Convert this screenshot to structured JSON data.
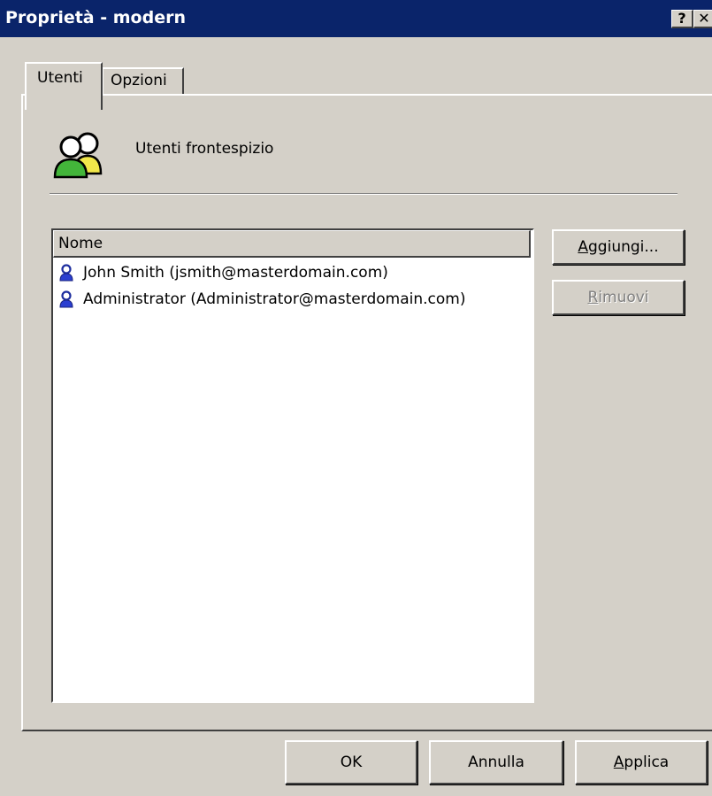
{
  "window": {
    "title": "Proprietà - modern",
    "help_glyph": "?",
    "close_glyph": "✕"
  },
  "tabs": [
    {
      "label": "Utenti",
      "selected": true
    },
    {
      "label": "Opzioni",
      "selected": false
    }
  ],
  "panel": {
    "group_label": "Utenti frontespizio",
    "list_header": "Nome",
    "users": [
      {
        "label": "John Smith (jsmith@masterdomain.com)",
        "icon": "user-icon"
      },
      {
        "label": "Administrator (Administrator@masterdomain.com)",
        "icon": "user-icon"
      }
    ],
    "add_button": {
      "accel": "A",
      "rest": "ggiungi..."
    },
    "remove_button": {
      "accel": "R",
      "rest": "imuovi",
      "disabled": true
    }
  },
  "footer": {
    "ok": "OK",
    "cancel": "Annulla",
    "apply": {
      "accel": "A",
      "rest": "pplica"
    }
  },
  "colors": {
    "titlebar": "#0a246a",
    "dialog_face": "#d4d0c8",
    "list_bg": "#ffffff"
  }
}
